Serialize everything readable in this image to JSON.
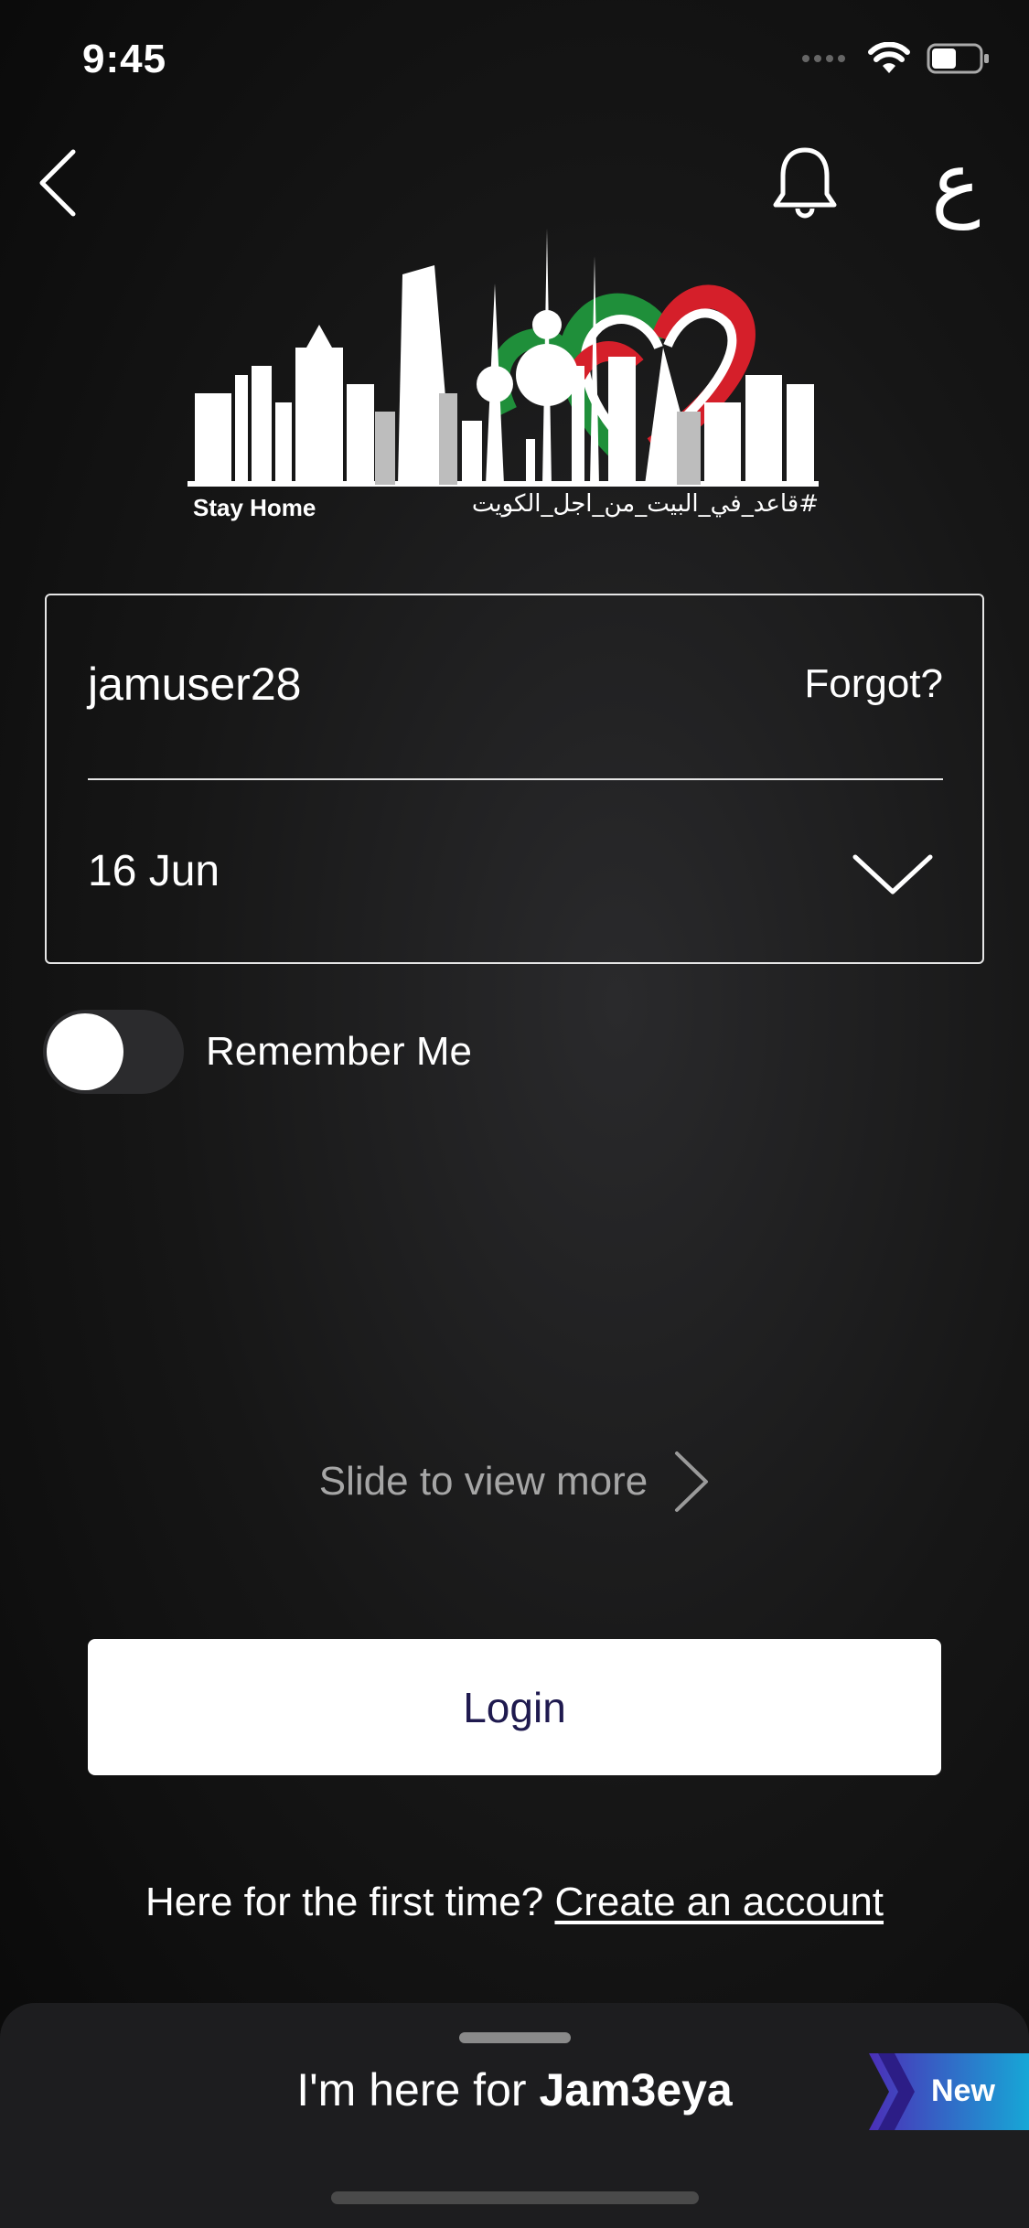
{
  "status_bar": {
    "time": "9:45"
  },
  "banner": {
    "english_text": "Stay Home",
    "arabic_text": "#قاعد_في_البيت_من_اجل_الكويت"
  },
  "nav": {
    "language_label": "ع"
  },
  "form": {
    "username_value": "jamuser28",
    "forgot_label": "Forgot?",
    "date_value": "16 Jun"
  },
  "remember": {
    "label": "Remember Me",
    "on": false
  },
  "slide_more": {
    "label": "Slide to view more"
  },
  "login": {
    "label": "Login"
  },
  "signup": {
    "prompt": "Here for the first time?",
    "link_label": "Create an account"
  },
  "bottom_sheet": {
    "prefix": "I'm here for",
    "brand": "Jam3eya",
    "badge": "New"
  },
  "colors": {
    "login_text": "#1f1a4f",
    "badge_gradient_start": "#4b2fb8",
    "badge_gradient_end": "#17a7d6",
    "flag_green": "#1f8f3a",
    "flag_red": "#d51f2a"
  }
}
